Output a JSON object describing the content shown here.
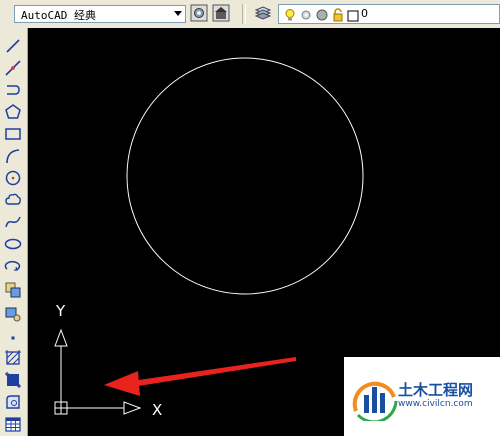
{
  "toolbar": {
    "workspace_value": "AutoCAD 经典",
    "icons": [
      "workspace-settings-icon",
      "workspace-save-icon",
      "layer-manager-icon"
    ]
  },
  "layer": {
    "current_name": "0",
    "icons": [
      "light-bulb-icon",
      "sun-icon",
      "lock-icon",
      "color-swatch-icon"
    ]
  },
  "draw_tools": [
    "line",
    "construction-line",
    "polyline",
    "polygon",
    "rectangle",
    "arc",
    "circle",
    "revision-cloud",
    "spline",
    "ellipse",
    "ellipse-arc",
    "insert-block",
    "make-block",
    "point",
    "hatch",
    "gradient",
    "region",
    "table"
  ],
  "canvas": {
    "background": "#000000",
    "ucs": {
      "x_label": "X",
      "y_label": "Y"
    },
    "annotation_color": "#e8231e"
  },
  "watermark": {
    "title": "土木工程网",
    "url": "www.civilcn.com"
  }
}
